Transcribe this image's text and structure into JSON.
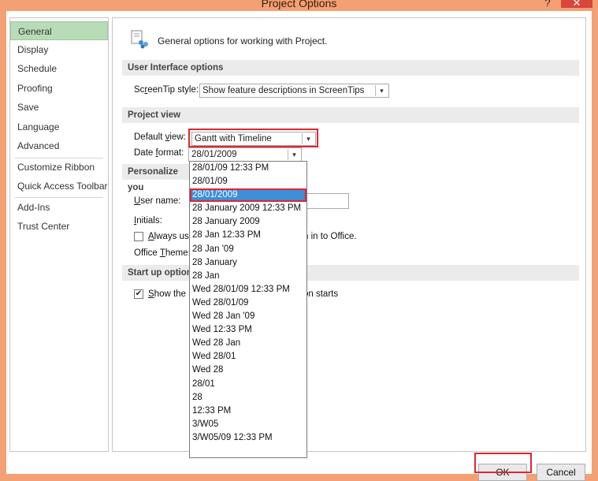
{
  "window": {
    "title": "Project Options",
    "help_label": "?",
    "close_label": "✕"
  },
  "nav": {
    "items": [
      {
        "label": "General",
        "selected": true
      },
      {
        "label": "Display"
      },
      {
        "label": "Schedule"
      },
      {
        "label": "Proofing"
      },
      {
        "label": "Save"
      },
      {
        "label": "Language"
      },
      {
        "label": "Advanced"
      },
      {
        "label": "Customize Ribbon"
      },
      {
        "label": "Quick Access Toolbar"
      },
      {
        "label": "Add-Ins"
      },
      {
        "label": "Trust Center"
      }
    ]
  },
  "header": {
    "text": "General options for working with Project."
  },
  "sections": {
    "ui_options": "User Interface options",
    "project_view": "Project view",
    "personalize": "Personalize you",
    "startup": "Start up options"
  },
  "ui": {
    "screentip_label_pre": "Sc",
    "screentip_label_u": "r",
    "screentip_label_post": "eenTip style:",
    "screentip_value": "Show feature descriptions in ScreenTips"
  },
  "view": {
    "default_view_label_pre": "Default ",
    "default_view_label_u": "v",
    "default_view_label_post": "iew:",
    "default_view_value": "Gantt with Timeline",
    "date_format_label_pre": "Date ",
    "date_format_label_u": "f",
    "date_format_label_post": "ormat:",
    "date_format_value": "28/01/2009"
  },
  "personalize": {
    "user_name_label_u": "U",
    "user_name_label_post": "ser name:",
    "initials_label_u": "I",
    "initials_label_post": "nitials:",
    "always_use_pre": "Always use",
    "always_use_u": "A",
    "always_use_rest": "lways use",
    "always_use_tail": "n in to Office.",
    "office_theme_pre": "Office ",
    "office_theme_u": "T",
    "office_theme_post": "heme:"
  },
  "startup": {
    "show_pre": "S",
    "show_post": "how the S",
    "show_tail": "on starts",
    "checked_mark": "✔"
  },
  "date_options": [
    "28/01/09 12:33 PM",
    "28/01/09",
    "28/01/2009",
    "28 January 2009 12:33 PM",
    "28 January 2009",
    "28 Jan 12:33 PM",
    "28 Jan '09",
    "28 January",
    "28 Jan",
    "Wed 28/01/09 12:33 PM",
    "Wed 28/01/09",
    "Wed 28 Jan '09",
    "Wed 12:33 PM",
    "Wed 28 Jan",
    "Wed 28/01",
    "Wed 28",
    "28/01",
    "28",
    "12:33 PM",
    "3/W05",
    "3/W05/09 12:33 PM"
  ],
  "buttons": {
    "ok": "OK",
    "cancel": "Cancel"
  },
  "colors": {
    "accent_red": "#e0262f",
    "selection_blue": "#3c8fd8",
    "nav_selected": "#b8dcb8",
    "title_bg": "#f3a074"
  }
}
